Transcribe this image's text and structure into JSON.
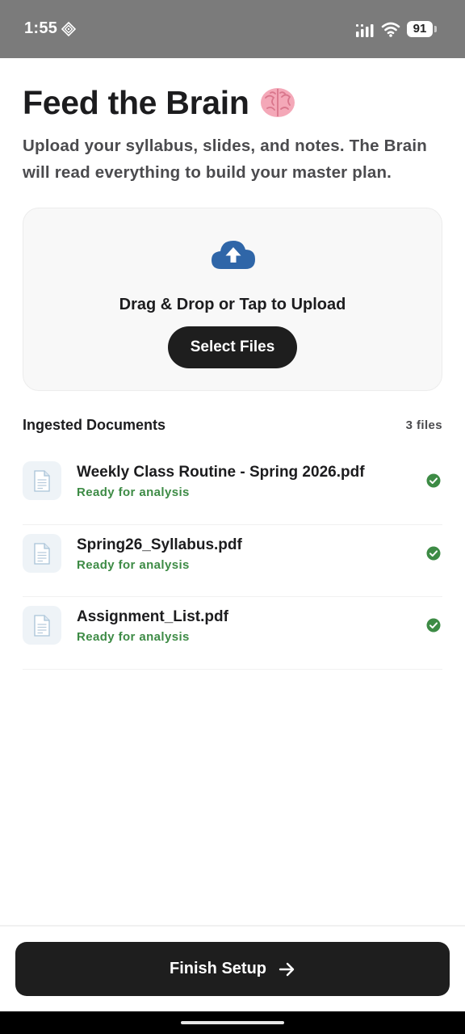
{
  "status_bar": {
    "time": "1:55",
    "battery": "91",
    "icons": [
      "diamond-icon",
      "signal-icon",
      "wifi-icon",
      "battery-icon"
    ]
  },
  "header": {
    "title": "Feed the Brain",
    "title_icon": "brain-icon",
    "subtitle": "Upload your syllabus, slides, and notes. The Brain will read everything to build your master plan."
  },
  "upload": {
    "icon": "cloud-upload-icon",
    "prompt": "Drag & Drop or Tap to Upload",
    "button_label": "Select Files"
  },
  "documents": {
    "heading": "Ingested Documents",
    "count": "3 files",
    "items": [
      {
        "name": "Weekly Class Routine - Spring 2026.pdf",
        "status": "Ready for analysis",
        "icon": "document-icon",
        "status_icon": "check-circle-icon"
      },
      {
        "name": "Spring26_Syllabus.pdf",
        "status": "Ready for analysis",
        "icon": "document-icon",
        "status_icon": "check-circle-icon"
      },
      {
        "name": "Assignment_List.pdf",
        "status": "Ready for analysis",
        "icon": "document-icon",
        "status_icon": "check-circle-icon"
      }
    ]
  },
  "footer": {
    "button_label": "Finish Setup",
    "button_icon": "arrow-right-icon"
  },
  "colors": {
    "accent_dark": "#1e1e1e",
    "success_green": "#3d8b45",
    "upload_blue": "#2f66a8",
    "status_bar_bg": "#7b7b7b"
  }
}
